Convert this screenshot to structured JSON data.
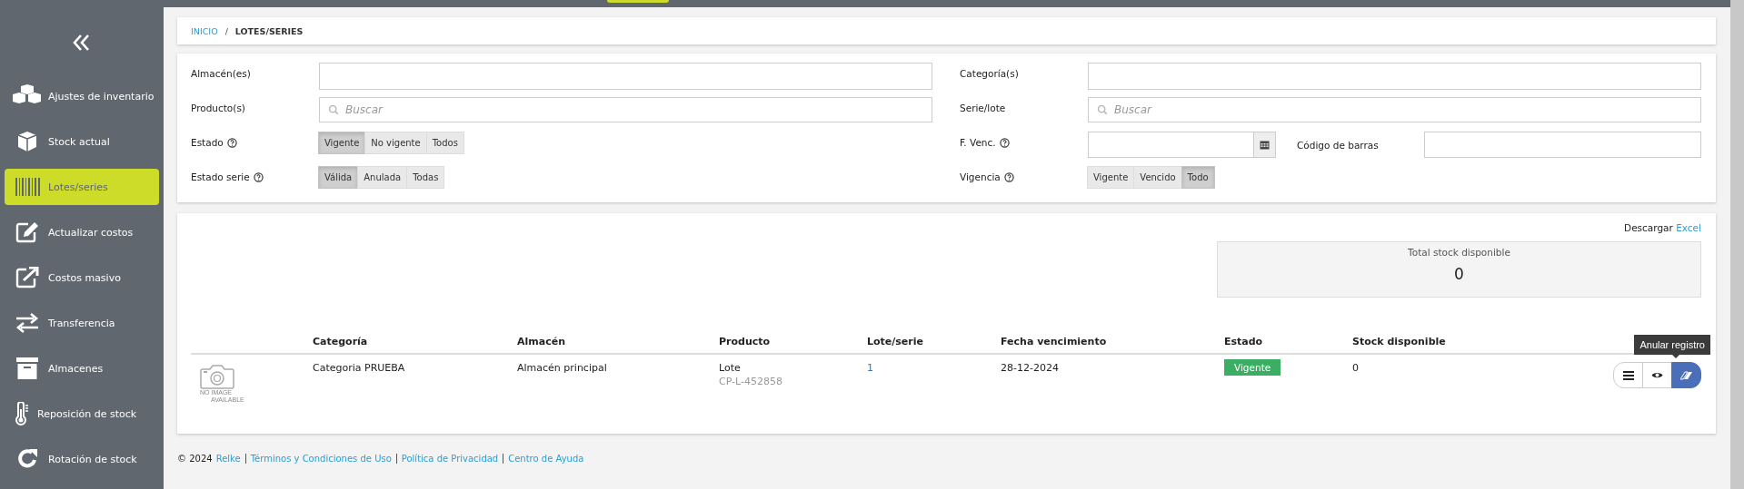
{
  "sidebar": {
    "items": [
      {
        "label": "Ajustes de inventario",
        "selected": false
      },
      {
        "label": "Stock actual",
        "selected": false
      },
      {
        "label": "Lotes/series",
        "selected": true
      },
      {
        "label": "Actualizar costos",
        "selected": false
      },
      {
        "label": "Costos masivo",
        "selected": false
      },
      {
        "label": "Transferencia",
        "selected": false
      },
      {
        "label": "Almacenes",
        "selected": false
      },
      {
        "label": "Reposición de stock",
        "selected": false
      },
      {
        "label": "Rotación de stock",
        "selected": false
      }
    ]
  },
  "breadcrumb": {
    "separator": "/",
    "items": [
      {
        "label": "INICIO",
        "link": true
      },
      {
        "label": "LOTES/SERIES",
        "link": false
      }
    ]
  },
  "filters": {
    "left": [
      {
        "kind": "input",
        "label": "Almacén(es)",
        "help": false
      },
      {
        "kind": "search",
        "label": "Producto(s)",
        "help": false,
        "placeholder": "Buscar"
      },
      {
        "kind": "segmented",
        "label": "Estado",
        "help": true,
        "options": [
          {
            "label": "Vigente",
            "selected": true
          },
          {
            "label": "No vigente",
            "selected": false
          },
          {
            "label": "Todos",
            "selected": false
          }
        ]
      },
      {
        "kind": "segmented",
        "label": "Estado serie",
        "help": true,
        "options": [
          {
            "label": "Válida",
            "selected": true
          },
          {
            "label": "Anulada",
            "selected": false
          },
          {
            "label": "Todas",
            "selected": false
          }
        ]
      }
    ],
    "right": [
      {
        "kind": "input",
        "label": "Categoría(s)",
        "help": false
      },
      {
        "kind": "search",
        "label": "Serie/lote",
        "help": false,
        "placeholder": "Buscar"
      },
      {
        "kind": "date",
        "label": "F. Venc.",
        "help": true,
        "extra_label": "Código de barras"
      },
      {
        "kind": "segmented",
        "label": "Vigencia",
        "help": true,
        "options": [
          {
            "label": "Vigente",
            "selected": false
          },
          {
            "label": "Vencido",
            "selected": false
          },
          {
            "label": "Todo",
            "selected": true
          }
        ]
      }
    ]
  },
  "results": {
    "download": {
      "text": "Descargar",
      "link": "Excel"
    },
    "total": {
      "label": "Total stock disponible",
      "value": "0"
    },
    "table": {
      "columns": [
        "Categoría",
        "Almacén",
        "Producto",
        "Lote/serie",
        "Fecha vencimiento",
        "Estado",
        "Stock disponible"
      ],
      "rows": [
        {
          "no_image": [
            "NO IMAGE",
            "AVAILABLE"
          ],
          "category": "Categoria PRUEBA",
          "warehouse": "Almacén principal",
          "product": "Lote",
          "product_code": "CP-L-452858",
          "lot": "1",
          "expiry": "28-12-2024",
          "status": "Vigente",
          "stock": "0",
          "actions": [
            {
              "kind": "list",
              "selected": false
            },
            {
              "kind": "view",
              "selected": false
            },
            {
              "kind": "void",
              "selected": true
            }
          ]
        }
      ]
    },
    "tooltip": "Anular registro"
  },
  "footer": {
    "copyright": "© 2024",
    "links": [
      "Relke",
      "Términos y Condiciones de Uso",
      "Política de Privacidad",
      "Centro de Ayuda"
    ]
  }
}
